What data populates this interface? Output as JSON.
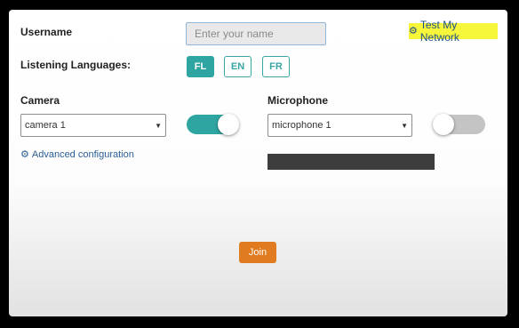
{
  "form": {
    "username_label": "Username",
    "username_placeholder": "Enter your name",
    "username_value": "",
    "test_network_label": "Test My Network",
    "languages_label": "Listening Languages:",
    "languages": [
      {
        "code": "FL",
        "selected": true
      },
      {
        "code": "EN",
        "selected": false
      },
      {
        "code": "FR",
        "selected": false
      }
    ],
    "camera_label": "Camera",
    "camera_selected": "camera 1",
    "camera_enabled": true,
    "microphone_label": "Microphone",
    "microphone_selected": "microphone 1",
    "microphone_enabled": false,
    "advanced_label": "Advanced configuration",
    "join_label": "Join"
  },
  "icons": {
    "test_network": "gear-icon",
    "advanced": "gear-icon",
    "dropdown": "caret-down-icon"
  },
  "colors": {
    "accent_teal": "#2fa5a2",
    "join_orange": "#e07b1f",
    "link_blue": "#2a5e92",
    "highlight_yellow": "#f6f63a",
    "toggle_off": "#c4c4c4"
  }
}
